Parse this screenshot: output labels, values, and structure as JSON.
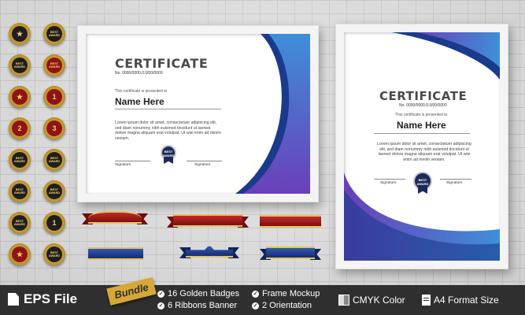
{
  "certificate_landscape": {
    "title": "CERTIFICATE",
    "number": "No. 0000/0000.0.0/00/0000",
    "subtitle": "This certificate is presented to",
    "name": "Name Here",
    "body": "Lorem ipsum dolor sit amet, consectetuer adipiscing elit, sed diam nonummy nibh euismod tincidunt ut laoreet dolore magna aliquam erat volutpat. Ut wisi enim ad minim veniam.",
    "signature_left": "Signature",
    "signature_right": "Signature",
    "seal_line1": "BEST",
    "seal_line2": "AWARD"
  },
  "certificate_portrait": {
    "title": "CERTIFICATE",
    "number": "No. 0000/0000.0.0/00/0000",
    "subtitle": "This certificate is presented to",
    "name": "Name Here",
    "body": "Lorem ipsum dolor sit amet, consectetuer adipiscing elit, sed diam nonummy nibh euismod tincidunt ut laoreet dolore magna aliquam erat volutpat. Ut wisi enim ad minim veniam.",
    "signature_left": "Signature",
    "signature_right": "Signature",
    "seal_line1": "BEST",
    "seal_line2": "AWARD"
  },
  "badges": [
    {
      "text": "★",
      "style": "dark"
    },
    {
      "text": "BEST AWARD",
      "style": "dark"
    },
    {
      "text": "BEST AWARD",
      "style": "dark"
    },
    {
      "text": "BEST AWARD",
      "style": "red"
    },
    {
      "text": "★",
      "style": "red"
    },
    {
      "text": "1",
      "style": "red"
    },
    {
      "text": "2",
      "style": "red"
    },
    {
      "text": "3",
      "style": "red"
    },
    {
      "text": "BEST AWARD",
      "style": "dark"
    },
    {
      "text": "BEST AWARD",
      "style": "dark"
    },
    {
      "text": "BEST AWARD",
      "style": "dark"
    },
    {
      "text": "BEST AWARD",
      "style": "dark"
    },
    {
      "text": "BEST AWARD",
      "style": "dark"
    },
    {
      "text": "1",
      "style": "dark"
    },
    {
      "text": "★",
      "style": "red"
    },
    {
      "text": "BEST AWARD",
      "style": "dark"
    }
  ],
  "ribbons_colors": {
    "red": "#9b1515",
    "blue": "#1f3c8a",
    "gold": "#e3c35a"
  },
  "footer": {
    "format": "EPS File",
    "bundle": "Bundle",
    "features": [
      "16 Golden Badges",
      "6  Ribbons Banner",
      "Frame Mockup",
      "2 Orientation"
    ],
    "color_mode": "CMYK Color",
    "paper_size": "A4 Format Size"
  },
  "colors": {
    "swoosh_blue": "#3f8fd8",
    "swoosh_purple": "#6a3fb8",
    "footer_bg": "#2f2f2f",
    "badge_gold": "#d6a936"
  }
}
